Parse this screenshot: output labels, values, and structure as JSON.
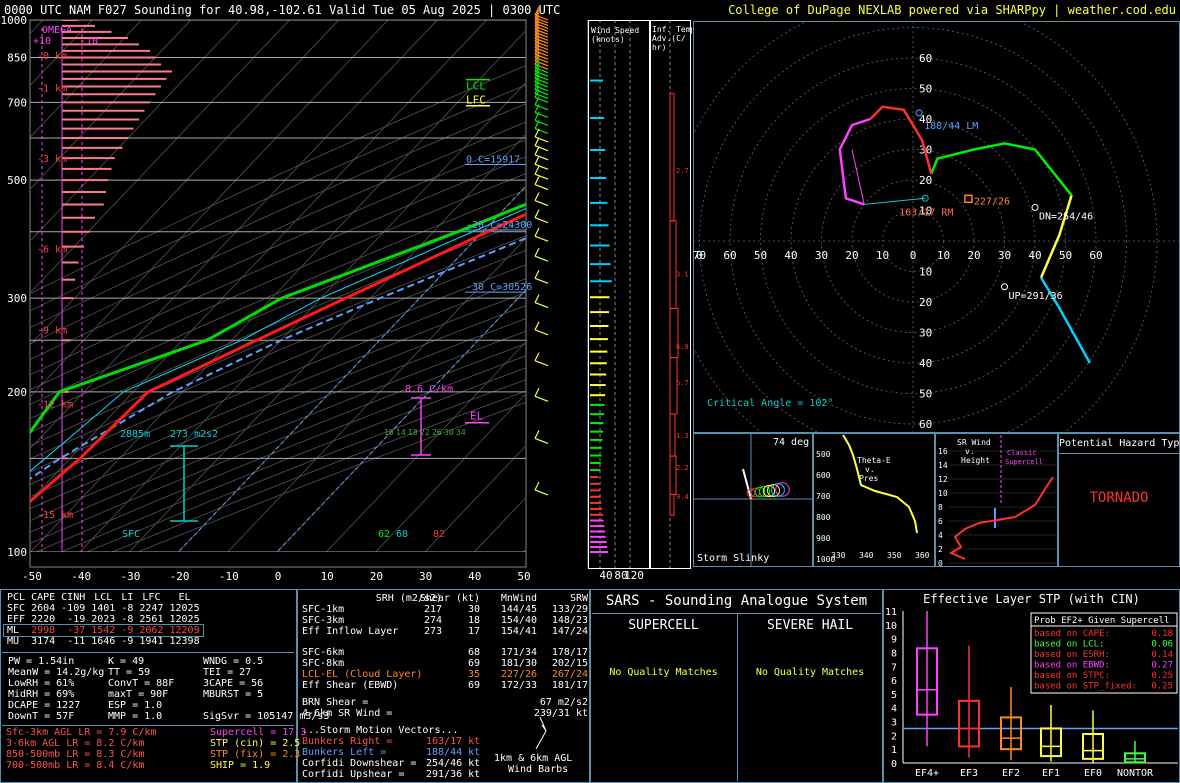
{
  "header": {
    "title": "0000 UTC NAM F027 Sounding for 40.98,-102.61 Valid  Tue 05 Aug 2025 | 0300 UTC",
    "credit": "College of DuPage NEXLAB powered via SHARPpy | weather.cod.edu"
  },
  "skewt": {
    "type": "line",
    "x_ticks": [
      "-50",
      "-40",
      "-30",
      "-20",
      "-10",
      "0",
      "10",
      "20",
      "30",
      "40",
      "50"
    ],
    "p_ticks": [
      "100",
      "200",
      "300",
      "500",
      "700",
      "850",
      "1000"
    ],
    "grid_p": [
      100,
      150,
      200,
      250,
      300,
      400,
      500,
      600,
      700,
      850,
      1000
    ],
    "height_labels": [
      "-15 km",
      "-12 km",
      "-9 km",
      "-6 km",
      "-3 km",
      "-1 km",
      "-0 km"
    ],
    "height_p": [
      118,
      190,
      262,
      372,
      550,
      747,
      860
    ],
    "omega_label": "OMEGA",
    "omega_sub": "+10",
    "omega_sub2": "-10",
    "temp": [
      [
        1000,
        38
      ],
      [
        925,
        32
      ],
      [
        850,
        27
      ],
      [
        700,
        16
      ],
      [
        600,
        7
      ],
      [
        500,
        -6
      ],
      [
        400,
        -19
      ],
      [
        300,
        -35
      ],
      [
        250,
        -45
      ],
      [
        200,
        -57
      ],
      [
        150,
        -58
      ],
      [
        100,
        -62
      ]
    ],
    "dewp": [
      [
        1000,
        25
      ],
      [
        925,
        23
      ],
      [
        850,
        20
      ],
      [
        700,
        12
      ],
      [
        600,
        -2
      ],
      [
        500,
        -9
      ],
      [
        400,
        -25
      ],
      [
        300,
        -48
      ],
      [
        250,
        -55
      ],
      [
        200,
        -75
      ],
      [
        150,
        -72
      ],
      [
        100,
        -80
      ]
    ],
    "wetbulb": [
      [
        1000,
        30
      ],
      [
        925,
        28
      ],
      [
        850,
        23
      ],
      [
        700,
        13
      ],
      [
        600,
        2
      ],
      [
        500,
        -8
      ],
      [
        400,
        -22
      ],
      [
        300,
        -40
      ],
      [
        250,
        -48
      ],
      [
        200,
        -62
      ],
      [
        150,
        -65
      ],
      [
        100,
        -70
      ]
    ],
    "parcel": [
      [
        1000,
        38
      ],
      [
        850,
        27
      ],
      [
        700,
        19
      ],
      [
        600,
        12
      ],
      [
        500,
        3
      ],
      [
        400,
        -8
      ],
      [
        300,
        -28
      ],
      [
        250,
        -40
      ],
      [
        200,
        -52
      ],
      [
        150,
        -62
      ],
      [
        100,
        -72
      ]
    ],
    "el_label": "EL",
    "el_p": 175,
    "lfc_label": "LFC",
    "lfc_p": 690,
    "lcl_label": "LCL",
    "lcl_p": 740,
    "iso_labels": [
      {
        "t": "-30 C=30526",
        "p": 308
      },
      {
        "t": "-20 C=24300",
        "p": 403
      },
      {
        "t": "0 C=15917",
        "p": 535
      }
    ],
    "lapse_label": "8.6 C/km",
    "eff_label": "273 m2s2",
    "eff_top": "2885m",
    "sfc_label": "SFC",
    "sfc_vals": [
      "62",
      "68",
      "82"
    ],
    "mixing_labels": [
      "10",
      "14",
      "18",
      "22",
      "26",
      "30",
      "34"
    ],
    "cape_bars": [
      [
        1000,
        0.15
      ],
      [
        975,
        0.3
      ],
      [
        950,
        0.45
      ],
      [
        925,
        0.6
      ],
      [
        900,
        0.7
      ],
      [
        875,
        0.8
      ],
      [
        850,
        0.85
      ],
      [
        825,
        0.9
      ],
      [
        800,
        1.0
      ],
      [
        775,
        0.95
      ],
      [
        750,
        0.9
      ],
      [
        725,
        0.85
      ],
      [
        700,
        0.8
      ],
      [
        675,
        0.75
      ],
      [
        650,
        0.7
      ],
      [
        625,
        0.65
      ],
      [
        600,
        0.6
      ],
      [
        575,
        0.55
      ],
      [
        550,
        0.48
      ],
      [
        525,
        0.45
      ],
      [
        500,
        0.42
      ],
      [
        475,
        0.4
      ],
      [
        450,
        0.38
      ],
      [
        425,
        0.3
      ],
      [
        400,
        0.25
      ],
      [
        375,
        0.2
      ],
      [
        350,
        0.15
      ],
      [
        325,
        0.12
      ],
      [
        300,
        0.1
      ],
      [
        250,
        0.08
      ],
      [
        200,
        0.06
      ],
      [
        150,
        0.05
      ]
    ]
  },
  "wind_speed": {
    "title1": "Wind Speed",
    "title2": "(knots)",
    "ticks": [
      "40",
      "80",
      "120"
    ]
  },
  "temp_adv": {
    "title1": "Inf. Temp.",
    "title2": "Adv.(C/",
    "title3": "hr)",
    "labels": [
      {
        "t": "2.7",
        "p": 208
      },
      {
        "t": "3.1",
        "p": 325
      },
      {
        "t": "6.9",
        "p": 445
      },
      {
        "t": "6.7",
        "p": 520
      },
      {
        "t": "1.3",
        "p": 655
      },
      {
        "t": "2.2",
        "p": 752
      },
      {
        "t": "9.4",
        "p": 852
      }
    ]
  },
  "hodograph": {
    "rings": [
      "10",
      "20",
      "30",
      "40",
      "50",
      "60"
    ],
    "lm_label": "188/44 LM",
    "rm_label": "163/17 RM",
    "mean_label": "227/26",
    "dn_label": "DN=254/46",
    "up_label": "UP=291/36",
    "crit_label": "Critical Angle = 102°"
  },
  "slinky": {
    "angle": "74 deg",
    "label": "Storm Slinky"
  },
  "theta": {
    "title1": "Theta-E",
    "title2": "v.",
    "title3": "Pres",
    "p_ticks": [
      "500",
      "600",
      "700",
      "800",
      "900",
      "1000"
    ],
    "x_ticks": [
      "330",
      "340",
      "350",
      "360"
    ]
  },
  "srwind": {
    "title1": "SR Wind",
    "title2": "v.",
    "title3": "Height",
    "classic": "Classic",
    "classic2": "Supercell",
    "h_ticks": [
      "0",
      "2",
      "4",
      "6",
      "8",
      "10",
      "12",
      "14",
      "16"
    ]
  },
  "hazard": {
    "title": "Potential Hazard Type",
    "value": "TORNADO"
  },
  "parcels": {
    "headers": [
      "PCL",
      "CAPE",
      "CINH",
      "LCL",
      "LI",
      "LFC",
      "EL"
    ],
    "rows": [
      [
        "SFC",
        "2604",
        "-109",
        "1401",
        "-8",
        "2247",
        "12025"
      ],
      [
        "EFF",
        "2220",
        "-19",
        "2023",
        "-8",
        "2561",
        "12025"
      ],
      [
        "ML",
        "2998",
        "-37",
        "1542",
        "-9",
        "2062",
        "12209"
      ],
      [
        "MU",
        "3174",
        "-11",
        "1646",
        "-9",
        "1941",
        "12398"
      ]
    ],
    "indices": [
      [
        "PW = 1.54in",
        "K = 49",
        "WNDG = 0.5"
      ],
      [
        "MeanW = 14.2g/kg",
        "TT = 59",
        "TEI = 27"
      ],
      [
        "LowRH = 61%",
        "ConvT = 88F",
        "3CAPE = 56"
      ],
      [
        "MidRH = 69%",
        "maxT = 90F",
        "MBURST = 5"
      ],
      [
        "DCAPE = 1227",
        "ESP = 1.0",
        ""
      ],
      [
        "DownT = 57F",
        "MMP = 1.0",
        "SigSvr = 105147 m3/s3"
      ]
    ],
    "lapse": [
      {
        "t": "Sfc-3km AGL LR = 7.9 C/km",
        "c": "#ff5050"
      },
      {
        "t": "3-6km AGL LR = 8.2 C/km",
        "c": "#ff5050"
      },
      {
        "t": "850-500mb LR = 8.3 C/km",
        "c": "#ff5050"
      },
      {
        "t": "700-500mb LR = 8.4 C/km",
        "c": "#ff5050"
      }
    ],
    "params": [
      {
        "t": "Supercell = 17.3",
        "c": "#ff40ff"
      },
      {
        "t": "STP (cin) = 2.5",
        "c": "#ffff40"
      },
      {
        "t": "STP (fix) = 2.3",
        "c": "#ff8c1a"
      },
      {
        "t": "SHIP = 1.9",
        "c": "#ffff40"
      }
    ]
  },
  "kinematics": {
    "headers": [
      "SRH (m2/s2)",
      "Shear (kt)",
      "MnWind",
      "SRW"
    ],
    "rows": [
      [
        "SFC-1km",
        "217",
        "30",
        "144/45",
        "133/29"
      ],
      [
        "SFC-3km",
        "274",
        "18",
        "154/40",
        "148/23"
      ],
      [
        "Eff Inflow Layer",
        "273",
        "17",
        "154/41",
        "147/24"
      ],
      [
        "SFC-6km",
        "",
        "68",
        "171/34",
        "178/17"
      ],
      [
        "SFC-8km",
        "",
        "69",
        "181/30",
        "202/15"
      ],
      [
        "LCL-EL (Cloud Layer)",
        "",
        "35",
        "227/26",
        "267/24"
      ],
      [
        "Eff Shear (EBWD)",
        "",
        "69",
        "172/33",
        "181/17"
      ]
    ],
    "brn": "BRN Shear =",
    "brn_v": "67 m2/s2",
    "sr46": "4-6km SR Wind =",
    "sr46_v": "239/31 kt",
    "motion_title": "...Storm Motion Vectors...",
    "motions": [
      {
        "k": "Bunkers Right =",
        "v": "163/17 kt",
        "c": "#ff5050"
      },
      {
        "k": "Bunkers Left =",
        "v": "188/44 kt",
        "c": "#5aa0ff"
      },
      {
        "k": "Corfidi Downshear =",
        "v": "254/46 kt",
        "c": "#ffffff"
      },
      {
        "k": "Corfidi Upshear =",
        "v": "291/36 kt",
        "c": "#ffffff"
      }
    ],
    "barbs_label1": "1km & 6km AGL",
    "barbs_label2": "Wind Barbs"
  },
  "sars": {
    "title": "SARS - Sounding Analogue System",
    "supercell": "SUPERCELL",
    "hail": "SEVERE HAIL",
    "no1": "No Quality Matches",
    "no2": "No Quality Matches"
  },
  "stp": {
    "title": "Effective Layer STP (with CIN)",
    "y_ticks": [
      "0",
      "1",
      "2",
      "3",
      "4",
      "5",
      "6",
      "7",
      "8",
      "9",
      "10",
      "11"
    ],
    "categories": [
      "EF4+",
      "EF3",
      "EF2",
      "EF1",
      "EF0",
      "NONTOR"
    ],
    "colors": [
      "#ff40ff",
      "#ff3030",
      "#ff8c1a",
      "#ffff40",
      "#ffff40",
      "#40ff40"
    ],
    "boxes": [
      [
        1.2,
        3.5,
        5.3,
        8.3,
        11
      ],
      [
        0.4,
        1.2,
        2.5,
        4.5,
        8.5
      ],
      [
        0.2,
        1.0,
        1.8,
        3.3,
        5.5
      ],
      [
        0.1,
        0.5,
        1.2,
        2.5,
        4.2
      ],
      [
        0,
        0.3,
        0.9,
        2.1,
        3.8
      ],
      [
        0,
        0.05,
        0.3,
        0.7,
        1.6
      ]
    ],
    "stp_value": 2.5,
    "prob_title": "Prob EF2+ Given Supercell",
    "probs": [
      {
        "k": "based on CAPE:",
        "v": "0.18",
        "c": "#ff3030"
      },
      {
        "k": "based on LCL:",
        "v": "0.06",
        "c": "#40ff40"
      },
      {
        "k": "based on ESRH:",
        "v": "0.14",
        "c": "#ff3030"
      },
      {
        "k": "based on EBWD:",
        "v": "0.27",
        "c": "#ff40ff"
      },
      {
        "k": "based on STPC:",
        "v": "0.25",
        "c": "#ff3030"
      },
      {
        "k": "based on STP_fixed:",
        "v": "0.25",
        "c": "#ff3030"
      }
    ]
  }
}
